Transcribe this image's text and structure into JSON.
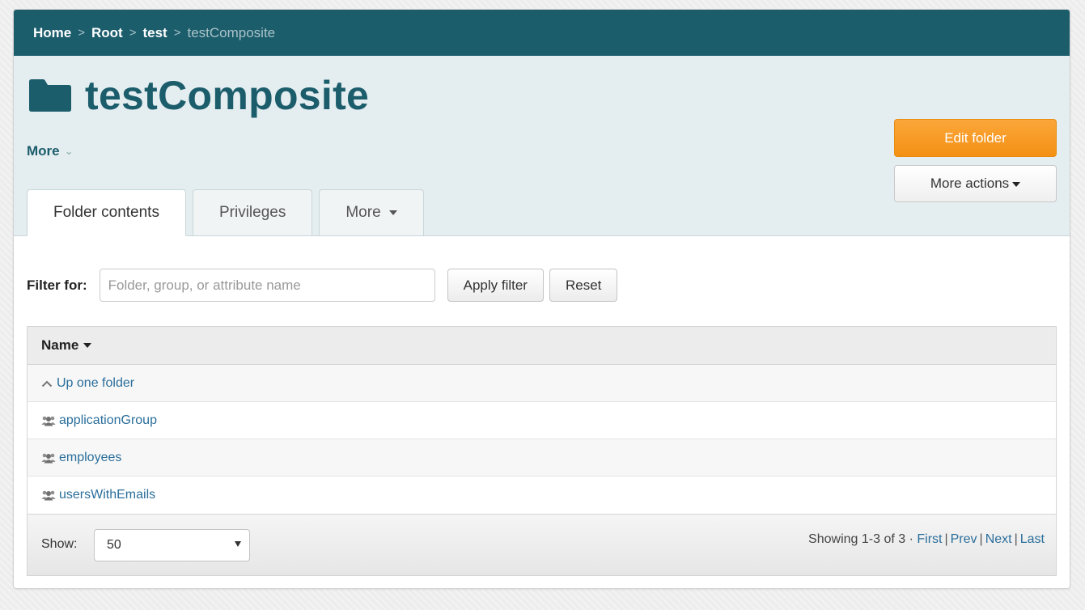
{
  "breadcrumb": {
    "items": [
      "Home",
      "Root",
      "test"
    ],
    "current": "testComposite",
    "separator": ">"
  },
  "header": {
    "title": "testComposite",
    "more_label": "More",
    "edit_button": "Edit folder",
    "more_actions_button": "More actions"
  },
  "tabs": [
    {
      "label": "Folder contents",
      "active": true
    },
    {
      "label": "Privileges",
      "active": false
    },
    {
      "label": "More",
      "active": false
    }
  ],
  "filter": {
    "label": "Filter for:",
    "placeholder": "Folder, group, or attribute name",
    "value": "",
    "apply_button": "Apply filter",
    "reset_button": "Reset"
  },
  "table": {
    "column_header": "Name",
    "up_label": "Up one folder",
    "rows": [
      "applicationGroup",
      "employees",
      "usersWithEmails"
    ]
  },
  "footer": {
    "show_label": "Show:",
    "page_size": "50",
    "showing_text": "Showing 1-3 of 3 ·",
    "links": [
      "First",
      "Prev",
      "Next",
      "Last"
    ]
  },
  "colors": {
    "brand": "#1c5d6c",
    "accent": "#f39114",
    "link": "#2a6e9b"
  },
  "icons": {
    "folder": "folder-icon",
    "group": "group-icon",
    "up": "chevron-up-icon"
  }
}
